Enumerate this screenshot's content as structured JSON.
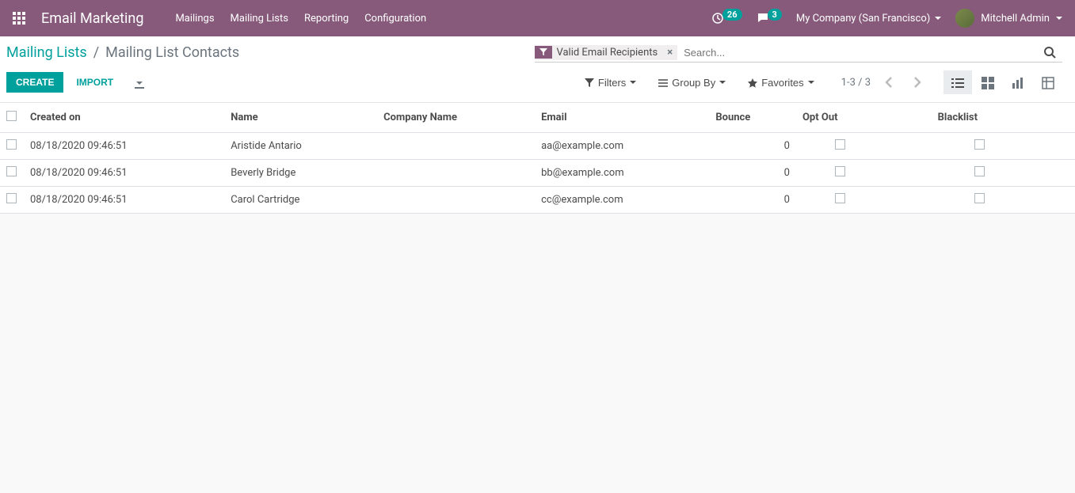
{
  "navbar": {
    "brand": "Email Marketing",
    "menu": [
      "Mailings",
      "Mailing Lists",
      "Reporting",
      "Configuration"
    ],
    "activities_count": "26",
    "messages_count": "3",
    "company": "My Company (San Francisco)",
    "user": "Mitchell Admin"
  },
  "breadcrumb": {
    "parent": "Mailing Lists",
    "current": "Mailing List Contacts"
  },
  "search": {
    "facet_label": "Valid Email Recipients",
    "placeholder": "Search..."
  },
  "buttons": {
    "create": "CREATE",
    "import": "IMPORT"
  },
  "options": {
    "filters": "Filters",
    "group_by": "Group By",
    "favorites": "Favorites"
  },
  "pager": {
    "text": "1-3 / 3"
  },
  "table": {
    "headers": {
      "created_on": "Created on",
      "name": "Name",
      "company_name": "Company Name",
      "email": "Email",
      "bounce": "Bounce",
      "opt_out": "Opt Out",
      "blacklist": "Blacklist"
    },
    "rows": [
      {
        "created_on": "08/18/2020 09:46:51",
        "name": "Aristide Antario",
        "company_name": "",
        "email": "aa@example.com",
        "bounce": "0"
      },
      {
        "created_on": "08/18/2020 09:46:51",
        "name": "Beverly Bridge",
        "company_name": "",
        "email": "bb@example.com",
        "bounce": "0"
      },
      {
        "created_on": "08/18/2020 09:46:51",
        "name": "Carol Cartridge",
        "company_name": "",
        "email": "cc@example.com",
        "bounce": "0"
      }
    ]
  }
}
